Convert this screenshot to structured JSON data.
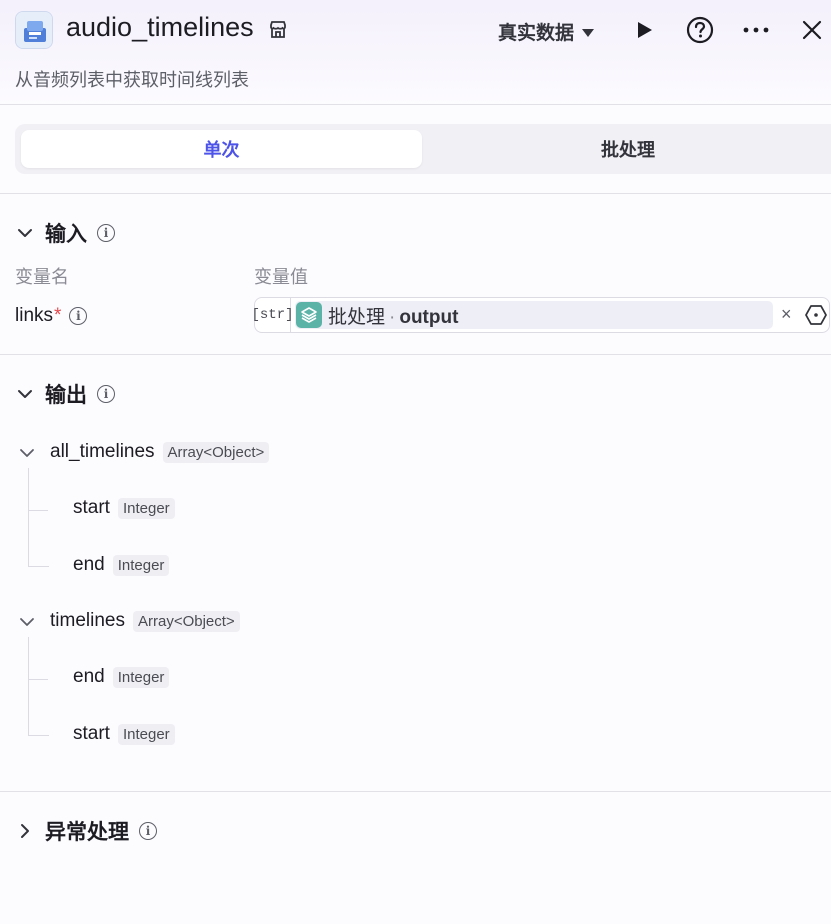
{
  "header": {
    "title": "audio_timelines",
    "subtitle": "从音频列表中获取时间线列表",
    "data_mode": "真实数据"
  },
  "tabs": [
    {
      "label": "单次",
      "active": true
    },
    {
      "label": "批处理",
      "active": false
    }
  ],
  "input": {
    "section_title": "输入",
    "col_name": "变量名",
    "col_value": "变量值",
    "field": {
      "name": "links",
      "required_mark": "*",
      "type_tag": "[str]",
      "ref_node": "批处理",
      "ref_sep": "·",
      "ref_var": "output",
      "clear": "×"
    }
  },
  "output": {
    "section_title": "输出",
    "items": [
      {
        "name": "all_timelines",
        "type": "Array<Object>",
        "children": [
          {
            "name": "start",
            "type": "Integer"
          },
          {
            "name": "end",
            "type": "Integer"
          }
        ]
      },
      {
        "name": "timelines",
        "type": "Array<Object>",
        "children": [
          {
            "name": "end",
            "type": "Integer"
          },
          {
            "name": "start",
            "type": "Integer"
          }
        ]
      }
    ]
  },
  "exception": {
    "section_title": "异常处理"
  },
  "colors": {
    "accent": "#4d53e8",
    "node_icon": "#5bb3a8",
    "required": "#e5484d"
  }
}
